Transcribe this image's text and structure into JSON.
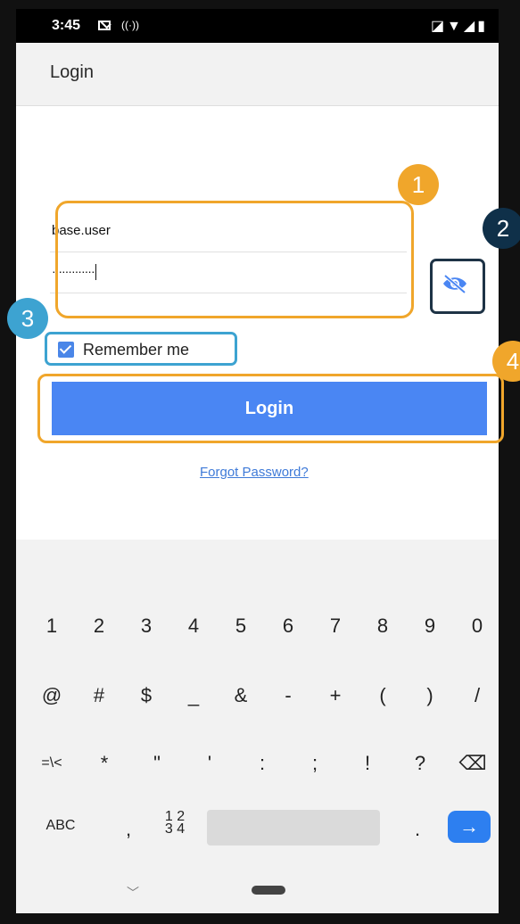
{
  "status_bar": {
    "time": "3:45",
    "right_icons": "◪▼◢▮"
  },
  "app_bar": {
    "title": "Login"
  },
  "form": {
    "username_value": "base.user",
    "password_value": "·············",
    "remember_label": "Remember me",
    "remember_checked": true,
    "login_label": "Login",
    "forgot_label": "Forgot Password?"
  },
  "annotations": [
    "1",
    "2",
    "3",
    "4"
  ],
  "keyboard": {
    "row1": [
      "1",
      "2",
      "3",
      "4",
      "5",
      "6",
      "7",
      "8",
      "9",
      "0"
    ],
    "row2": [
      "@",
      "#",
      "$",
      "_",
      "&",
      "-",
      "+",
      "(",
      ")",
      "/"
    ],
    "row3": [
      "=\\<",
      "*",
      "\"",
      "'",
      ":",
      ";",
      "!",
      "?",
      "⌫"
    ],
    "row4": {
      "abc": "ABC",
      "comma": ",",
      "num": "1 2\n3 4",
      "period": ".",
      "enter": "→"
    },
    "nav_down": "﹀"
  },
  "colors": {
    "accent": "#4a86f3",
    "highlight_orange": "#f0a62b",
    "highlight_blue": "#3da3d1",
    "badge_dark": "#0f3049"
  }
}
